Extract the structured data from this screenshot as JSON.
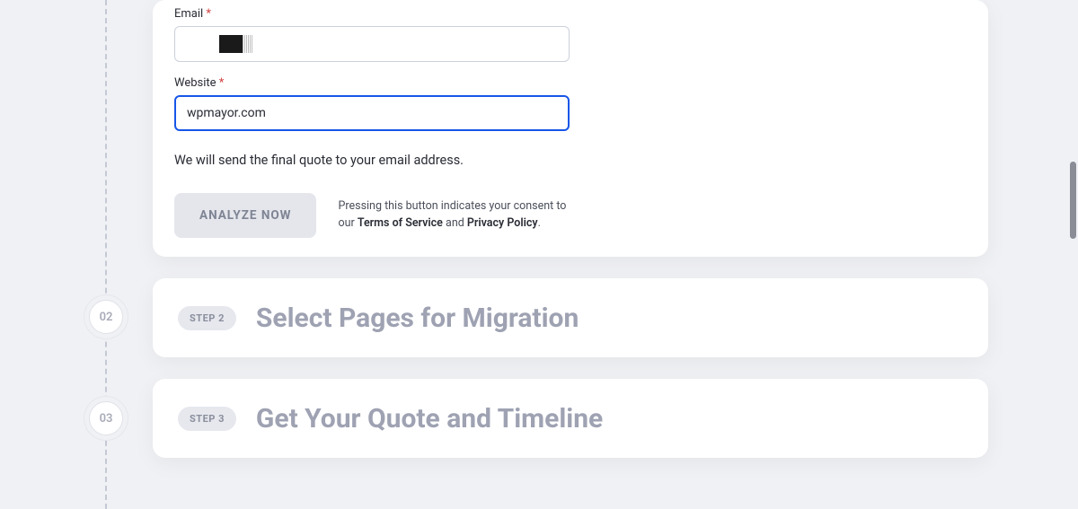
{
  "form": {
    "email": {
      "label": "Email",
      "value": ""
    },
    "website": {
      "label": "Website",
      "value": "wpmayor.com"
    },
    "info_text": "We will send the final quote to your email address.",
    "submit_label": "ANALYZE NOW",
    "consent_prefix": "Pressing this button indicates your consent to our ",
    "consent_tos": "Terms of Service",
    "consent_and": " and ",
    "consent_privacy": "Privacy Policy",
    "consent_suffix": "."
  },
  "steps": {
    "s2": {
      "num": "02",
      "pill": "STEP 2",
      "title": "Select Pages for Migration"
    },
    "s3": {
      "num": "03",
      "pill": "STEP 3",
      "title": "Get Your Quote and Timeline"
    }
  }
}
